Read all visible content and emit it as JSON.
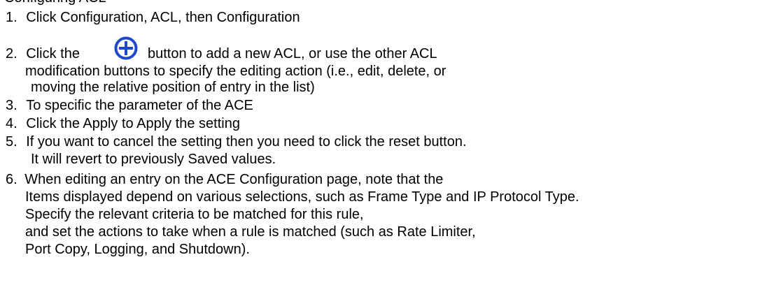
{
  "heading_partial": "Configuring ACL",
  "steps": [
    {
      "num": "1.",
      "text": "Click Configuration, ACL, then Configuration"
    },
    {
      "num": "2.",
      "text_before": "Click the",
      "icon": "add-circle-icon",
      "text_after": "button to add a new ACL, or use the other ACL"
    },
    {
      "text": "modification buttons to specify the editing action (i.e., edit, delete, or"
    },
    {
      "text": "moving the relative position of entry in the list)"
    },
    {
      "num": "3.",
      "text": "To specific the parameter of the ACE"
    },
    {
      "num": "4.",
      "text": "Click the Apply to Apply the setting"
    },
    {
      "num": "5.",
      "text": "If you want to cancel the setting then you need to click the reset button."
    },
    {
      "text": "It will revert to previously Saved values."
    },
    {
      "num": "6.",
      "text": "When editing an entry on the ACE Configuration page, note that the"
    },
    {
      "text": "Items displayed depend on various selections, such as Frame Type and IP Protocol Type."
    },
    {
      "text": "Specify the relevant criteria to be matched for this rule,"
    },
    {
      "text": "and set the actions to take when a rule is matched (such as Rate Limiter,"
    },
    {
      "text": "Port Copy, Logging, and Shutdown)."
    }
  ],
  "icon_color": "#1f49c7"
}
